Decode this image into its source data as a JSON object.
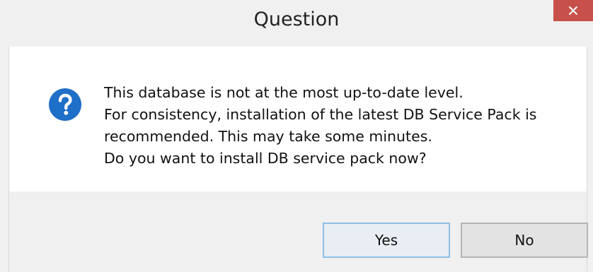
{
  "window": {
    "title": "Question",
    "close_glyph": "✕"
  },
  "message": {
    "icon": "question-icon",
    "lines": [
      "This database is not at the most up-to-date level.",
      "For consistency, installation of the latest DB Service Pack is",
      "recommended. This may take some minutes.",
      "Do you want to install DB service pack now?"
    ]
  },
  "buttons": {
    "yes_label": "Yes",
    "no_label": "No"
  },
  "colors": {
    "close_button": "#c7514a",
    "icon_blue": "#1e6fc8",
    "dialog_background": "#f0f0f0",
    "content_background": "#ffffff",
    "default_button_border": "#8fbfe6"
  }
}
